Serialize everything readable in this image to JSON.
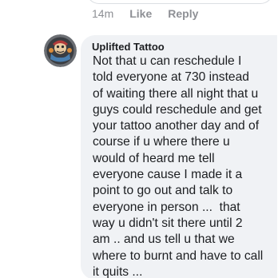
{
  "previous_comment": {
    "time": "14m",
    "like_label": "Like",
    "reply_label": "Reply"
  },
  "comment": {
    "author": "Uplifted Tattoo",
    "avatar_icon": "tattoo-shop-logo",
    "text": "Not that u can reschedule I\ntold everyone at 730 instead\nof waiting there all night that u\nguys could reschedule and get\nyour tattoo another day and of\ncourse if u where there u\nwould of heard me tell\neveryone cause I made it a\npoint to go out and talk to\neveryone in person ...  that\nway u didn't sit there until 2\nam .. and us tell u that we\nwhere to burnt and have to call\nit quits ..."
  },
  "colors": {
    "bubble": "#f0f2f5",
    "text": "#1c1e21",
    "meta": "#8e9095"
  }
}
